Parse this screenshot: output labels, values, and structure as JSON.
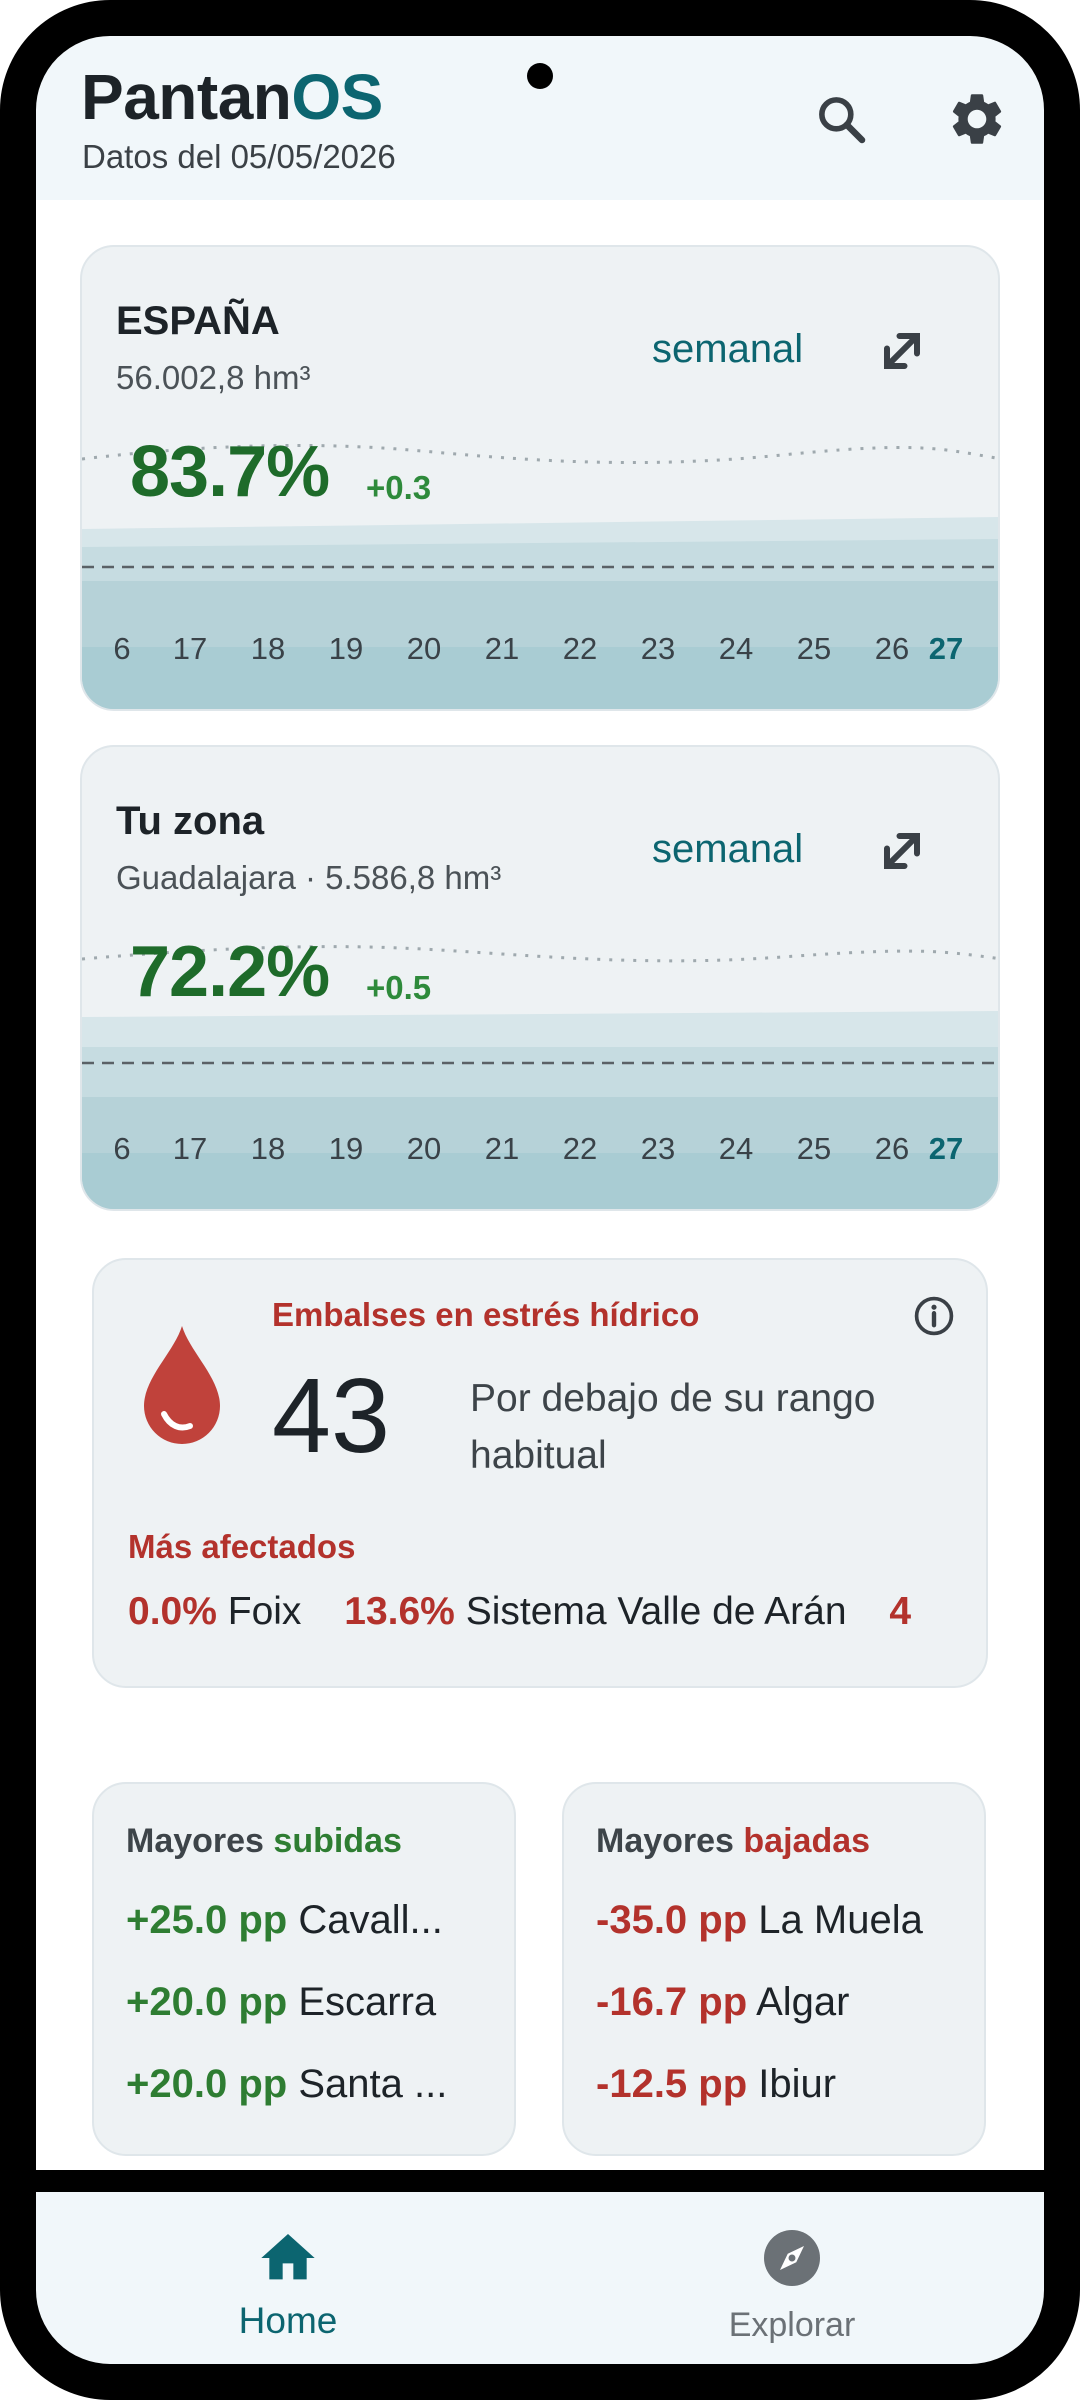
{
  "app": {
    "title_main": "Pantan",
    "title_accent": "OS",
    "subtitle": "Datos del 05/05/2026"
  },
  "header": {
    "icons": [
      "search-icon",
      "gear-icon"
    ]
  },
  "spain_card": {
    "title": "ESPAÑA",
    "volume": "56.002,8 hm³",
    "period": "semanal",
    "percent": "83.7%",
    "delta": "+0.3",
    "level": 0.837,
    "days": [
      "6",
      "17",
      "18",
      "19",
      "20",
      "21",
      "22",
      "23",
      "24",
      "25",
      "26",
      "27"
    ],
    "today": "27"
  },
  "zone_card": {
    "title": "Tu zona",
    "subtitle": "Guadalajara · 5.586,8 hm³",
    "period": "semanal",
    "percent": "72.2%",
    "delta": "+0.5",
    "level": 0.722,
    "days": [
      "6",
      "17",
      "18",
      "19",
      "20",
      "21",
      "22",
      "23",
      "24",
      "25",
      "26",
      "27"
    ],
    "today": "27"
  },
  "stress": {
    "title": "Embalses en estrés hídrico",
    "count": "43",
    "description": "Por debajo de su rango habitual",
    "affected_title": "Más afectados",
    "affected": [
      {
        "pct": "0.0%",
        "name": "Foix"
      },
      {
        "pct": "13.6%",
        "name": "Sistema Valle de Arán"
      },
      {
        "pct": "4",
        "name": ""
      }
    ]
  },
  "rises": {
    "title_prefix": "Mayores ",
    "title_word": "subidas",
    "items": [
      {
        "pp": "+25.0 pp",
        "name": "Cavall..."
      },
      {
        "pp": "+20.0 pp",
        "name": "Escarra"
      },
      {
        "pp": "+20.0 pp",
        "name": "Santa ..."
      }
    ]
  },
  "drops": {
    "title_prefix": "Mayores ",
    "title_word": "bajadas",
    "items": [
      {
        "pp": "-35.0 pp",
        "name": "La Muela"
      },
      {
        "pp": "-16.7 pp",
        "name": "Algar"
      },
      {
        "pp": "-12.5 pp",
        "name": "Ibiur"
      }
    ]
  },
  "nav": {
    "home_label": "Home",
    "explore_label": "Explorar"
  },
  "colors": {
    "accent": "#0c6570",
    "up": "#2e7d32",
    "down": "#b3322c",
    "water": "#a9ccd3"
  }
}
